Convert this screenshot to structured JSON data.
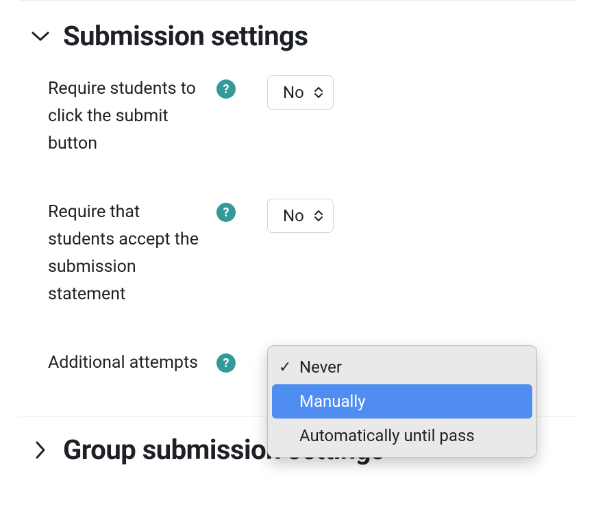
{
  "sections": {
    "submission": {
      "title": "Submission settings",
      "expanded": true,
      "fields": {
        "require_click_submit": {
          "label": "Require students to click the submit button",
          "value": "No"
        },
        "require_accept_statement": {
          "label": "Require that students accept the submission statement",
          "value": "No"
        },
        "additional_attempts": {
          "label": "Additional attempts",
          "value": "Never",
          "options": {
            "never": "Never",
            "manually": "Manually",
            "auto": "Automatically until pass"
          },
          "selected_key": "never",
          "highlighted_key": "manually",
          "open": true
        }
      }
    },
    "group_submission": {
      "title": "Group submission settings",
      "expanded": false
    }
  },
  "help_glyph": "?",
  "check_glyph": "✓"
}
